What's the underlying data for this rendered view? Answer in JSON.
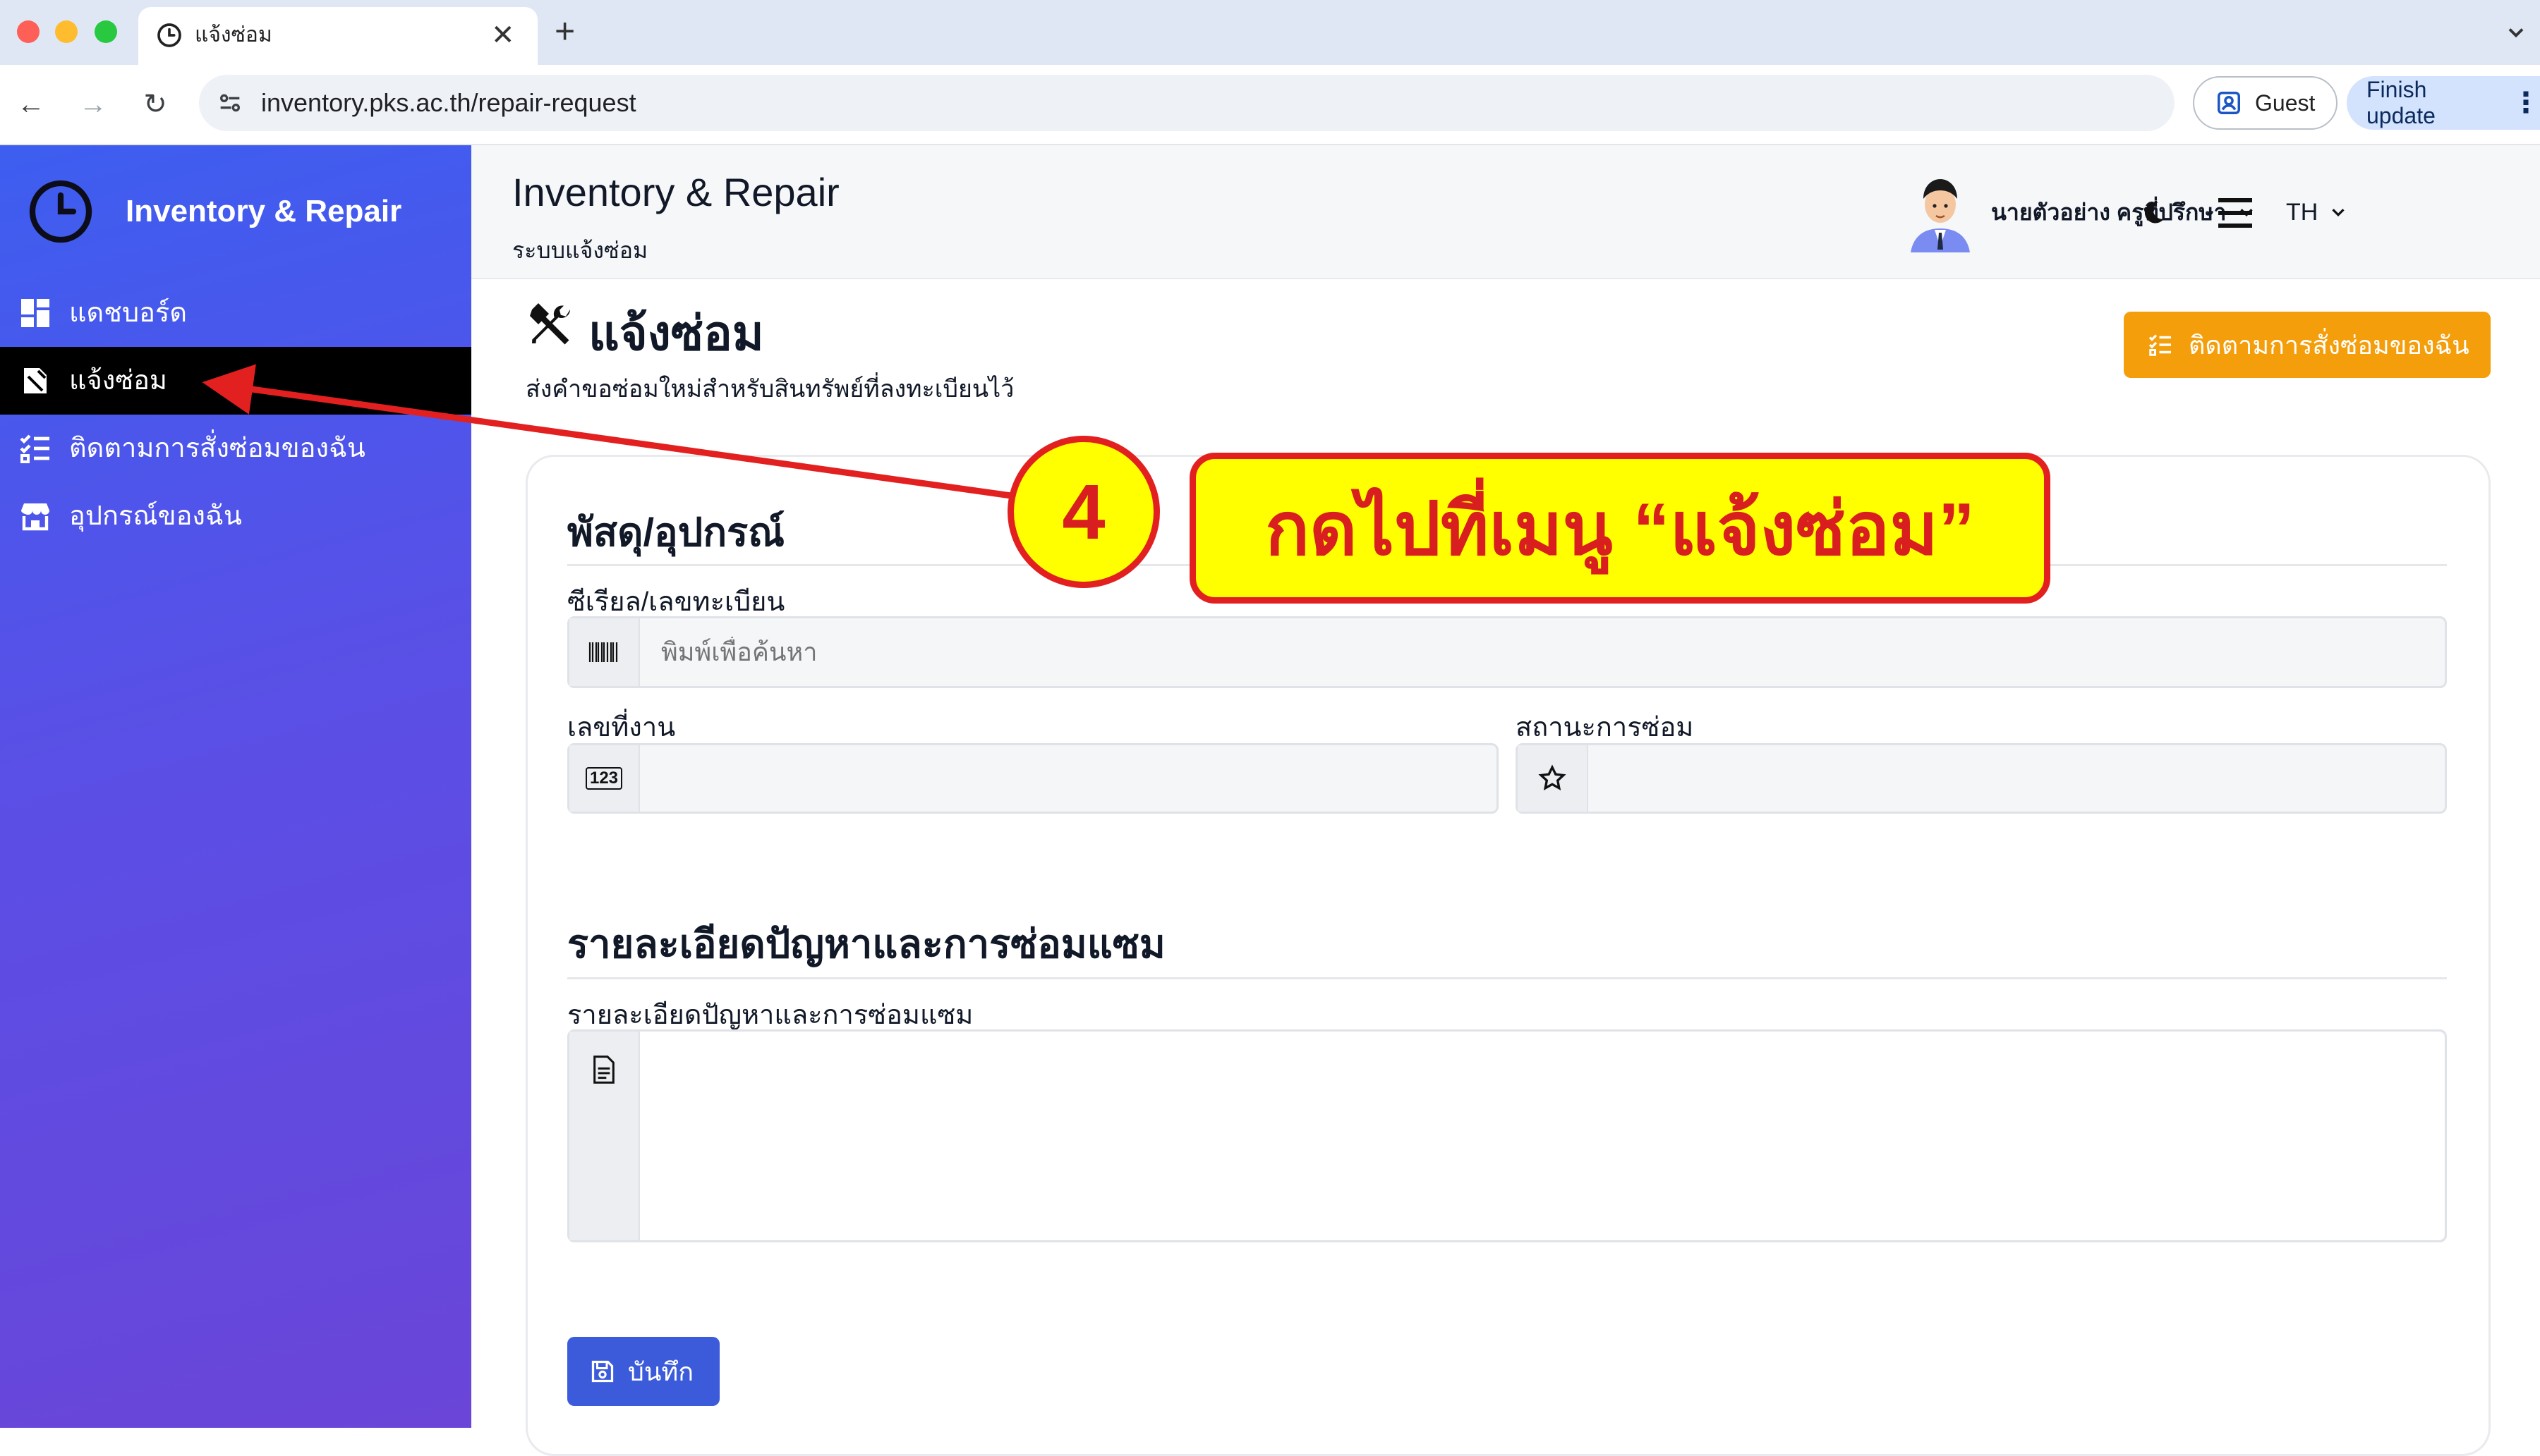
{
  "browser": {
    "tab_title": "แจ้งซ่อม",
    "new_tab_label": "+",
    "url": "inventory.pks.ac.th/repair-request",
    "guest_label": "Guest",
    "finish_update_label": "Finish update"
  },
  "sidebar": {
    "brand": "Inventory & Repair",
    "items": [
      {
        "label": "แดชบอร์ด",
        "icon": "dashboard-icon"
      },
      {
        "label": "แจ้งซ่อม",
        "icon": "repair-note-icon",
        "active": true
      },
      {
        "label": "ติดตามการสั่งซ่อมของฉัน",
        "icon": "checklist-icon"
      },
      {
        "label": "อุปกรณ์ของฉัน",
        "icon": "store-icon"
      }
    ]
  },
  "header": {
    "title": "Inventory & Repair",
    "subtitle": "ระบบแจ้งซ่อม",
    "user_name": "นายตัวอย่าง ครูที่ปรึกษา",
    "language": "TH"
  },
  "page": {
    "title": "แจ้งซ่อม",
    "description": "ส่งคำขอซ่อมใหม่สำหรับสินทรัพย์ที่ลงทะเบียนไว้",
    "track_button": "ติดตามการสั่งซ่อมของฉัน"
  },
  "form": {
    "section_equipment": "พัสดุ/อุปกรณ์",
    "serial_label": "ซีเรียล/เลขทะเบียน",
    "serial_placeholder": "พิมพ์เพื่อค้นหา",
    "job_no_label": "เลขที่งาน",
    "job_no_icon_text": "123",
    "status_label": "สถานะการซ่อม",
    "section_detail": "รายละเอียดปัญหาและการซ่อมแซม",
    "detail_label": "รายละเอียดปัญหาและการซ่อมแซม",
    "save_button": "บันทึก"
  },
  "annotation": {
    "step_number": "4",
    "callout_text": "กดไปที่เมนู “แจ้งซ่อม”"
  },
  "colors": {
    "sidebar_gradient_start": "#3d5ef0",
    "sidebar_gradient_end": "#6a45d8",
    "active_item_bg": "#000000",
    "track_button_bg": "#f59e0b",
    "save_button_bg": "#3b5bdb",
    "callout_fill": "#ffff00",
    "callout_border": "#e32020"
  }
}
